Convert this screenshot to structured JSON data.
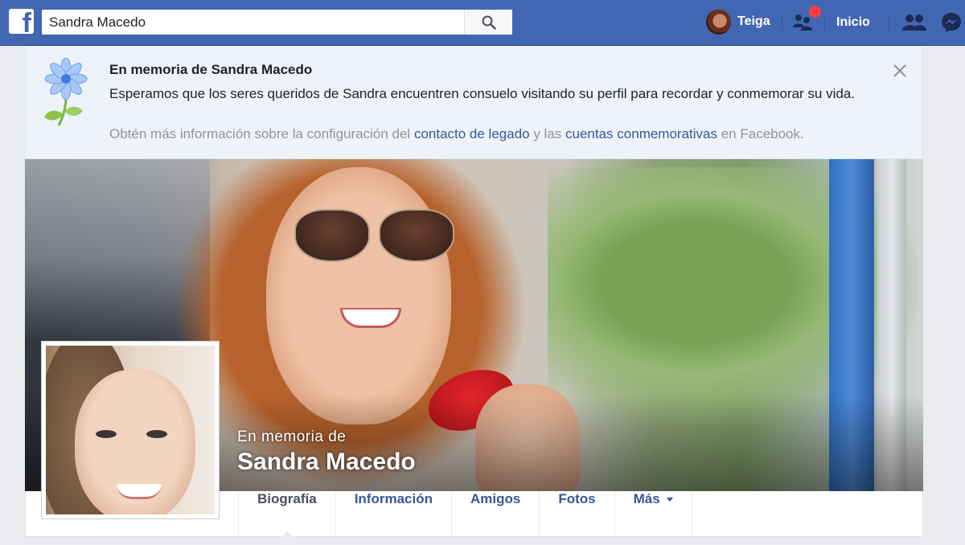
{
  "topbar": {
    "logo_letter": "f",
    "search": {
      "value": "Sandra Macedo",
      "placeholder": "Buscar"
    },
    "user": {
      "name": "Teiga"
    },
    "home_label": "Inicio"
  },
  "memorial_banner": {
    "title": "En memoria de Sandra Macedo",
    "body": "Esperamos que los seres queridos de Sandra encuentren consuelo visitando su perfil para recordar y conmemorar su vida.",
    "info_prefix": "Obtén más información sobre la configuración del ",
    "link_legacy": "contacto de legado",
    "info_middle": " y las ",
    "link_memorialized": "cuentas conmemorativas",
    "info_suffix": " en Facebook."
  },
  "cover": {
    "subtitle": "En memoria de",
    "name": "Sandra Macedo"
  },
  "tabs": [
    {
      "label": "Biografía",
      "active": true
    },
    {
      "label": "Información",
      "active": false
    },
    {
      "label": "Amigos",
      "active": false
    },
    {
      "label": "Fotos",
      "active": false
    },
    {
      "label": "Más",
      "active": false
    }
  ],
  "colors": {
    "brand_blue": "#4267b2",
    "link_blue": "#365899",
    "banner_bg": "#eef3f9",
    "notification_red": "#fa3e3e"
  },
  "icons": {
    "search": "search-icon",
    "friend_requests": "friend-requests-icon",
    "people": "people-icon",
    "messenger": "messenger-icon",
    "close": "close-icon",
    "flower": "memorial-flower-icon"
  }
}
